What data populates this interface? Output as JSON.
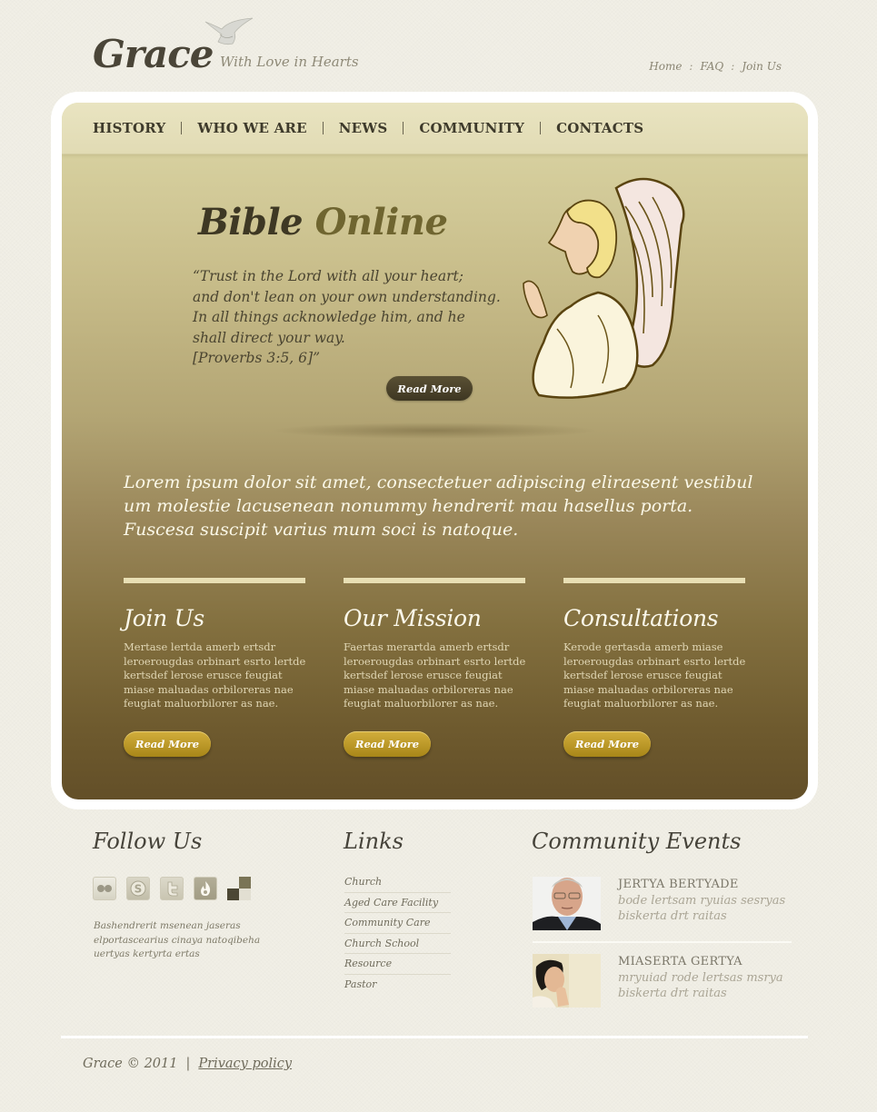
{
  "header": {
    "logo": "Grace",
    "tagline": "With Love in Hearts",
    "top_links": [
      {
        "label": "Home"
      },
      {
        "label": "FAQ"
      },
      {
        "label": "Join Us"
      }
    ],
    "separator": ":"
  },
  "nav": {
    "items": [
      {
        "label": "HISTORY"
      },
      {
        "label": "WHO WE ARE"
      },
      {
        "label": "NEWS"
      },
      {
        "label": "COMMUNITY"
      },
      {
        "label": "CONTACTS"
      }
    ]
  },
  "hero": {
    "title_part1": "Bible",
    "title_part2": "Online",
    "quote_lines": [
      "“Trust in the Lord with all your heart;",
      "and don't lean on your own understanding.",
      "In all things acknowledge him, and he",
      "shall direct your way.",
      "[Proverbs 3:5, 6]”"
    ],
    "button_label": "Read More"
  },
  "lead_text": "Lorem ipsum dolor sit amet, consectetuer adipiscing eliraesent vestibul um molestie lacusenean nonummy hendrerit mau hasellus porta. Fuscesa suscipit varius mum soci is natoque.",
  "columns": [
    {
      "title": "Join Us",
      "text": "Mertase lertda amerb ertsdr leroerougdas orbinart esrto lertde kertsdef lerose erusce feugiat miase maluadas orbiloreras nae feugiat maluorbilorer as nae.",
      "button_label": "Read More"
    },
    {
      "title": "Our Mission",
      "text": "Faertas merartda amerb ertsdr leroerougdas orbinart esrto lertde kertsdef lerose erusce feugiat miase maluadas orbiloreras nae feugiat maluorbilorer as nae.",
      "button_label": "Read More"
    },
    {
      "title": "Consultations",
      "text": "Kerode gertasda amerb miase leroerougdas orbinart esrto lertde kertsdef lerose erusce feugiat miase maluadas orbiloreras nae feugiat maluorbilorer as nae.",
      "button_label": "Read More"
    }
  ],
  "follow": {
    "title": "Follow Us",
    "icons": [
      "flickr-icon",
      "skype-icon",
      "twitter-icon",
      "flame-icon",
      "delicious-icon"
    ],
    "text": "Bashendrerit msenean jaseras elportascearius cinaya natoqibeha uertyas kertyrta ertas"
  },
  "links": {
    "title": "Links",
    "items": [
      {
        "label": "Church"
      },
      {
        "label": "Aged Care Facility"
      },
      {
        "label": "Community Care"
      },
      {
        "label": "Church School"
      },
      {
        "label": "Resource"
      },
      {
        "label": "Pastor"
      }
    ]
  },
  "events": {
    "title": "Community Events",
    "items": [
      {
        "name": "JERTYA BERTYADE",
        "desc": "bode lertsam ryuias sesryas biskerta drt raitas"
      },
      {
        "name": "MIASERTA GERTYA",
        "desc": "mryuiad rode lertsas msrya biskerta drt raitas"
      }
    ]
  },
  "footer": {
    "copyright": "Grace © 2011",
    "separator": "|",
    "privacy_label": "Privacy policy"
  },
  "colors": {
    "accent_gold": "#c09f2e",
    "dark_button": "#4a4129",
    "text_dark": "#3e3a2b"
  }
}
